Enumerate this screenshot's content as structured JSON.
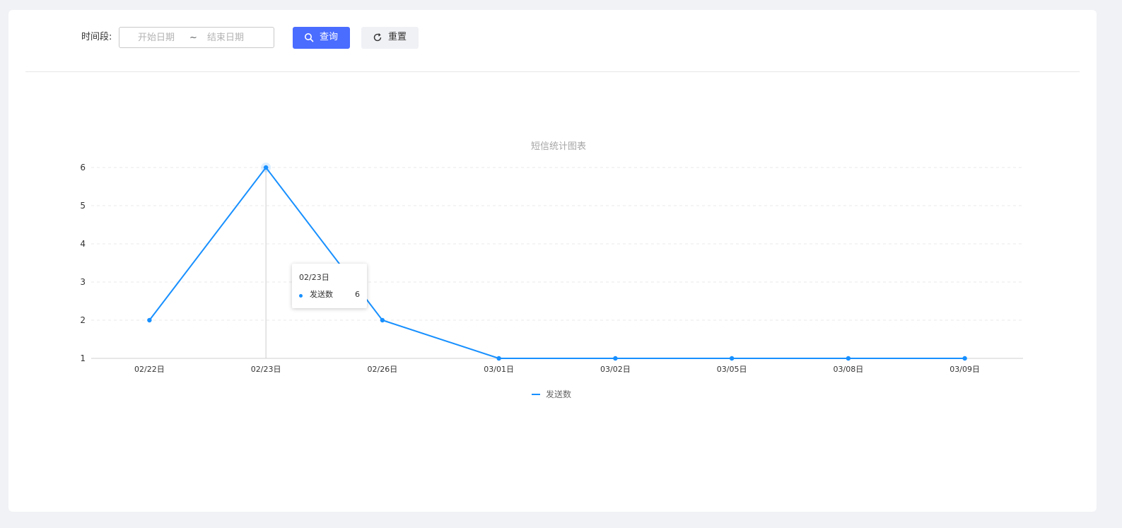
{
  "filter": {
    "label": "时间段:",
    "start_placeholder": "开始日期",
    "separator": "~",
    "end_placeholder": "结束日期",
    "search_label": "查询",
    "reset_label": "重置"
  },
  "colors": {
    "accent": "#4a6cff",
    "series": "#1890ff"
  },
  "tooltip": {
    "title": "02/23日",
    "series": "发送数",
    "value": "6"
  },
  "chart_data": {
    "type": "line",
    "title": "短信统计图表",
    "categories": [
      "02/22日",
      "02/23日",
      "02/26日",
      "03/01日",
      "03/02日",
      "03/05日",
      "03/08日",
      "03/09日"
    ],
    "series": [
      {
        "name": "发送数",
        "values": [
          2,
          6,
          2,
          1,
          1,
          1,
          1,
          1
        ]
      }
    ],
    "ylim": [
      1,
      6
    ],
    "yticks": [
      1,
      2,
      3,
      4,
      5,
      6
    ],
    "grid": true,
    "legend": "bottom-center"
  }
}
